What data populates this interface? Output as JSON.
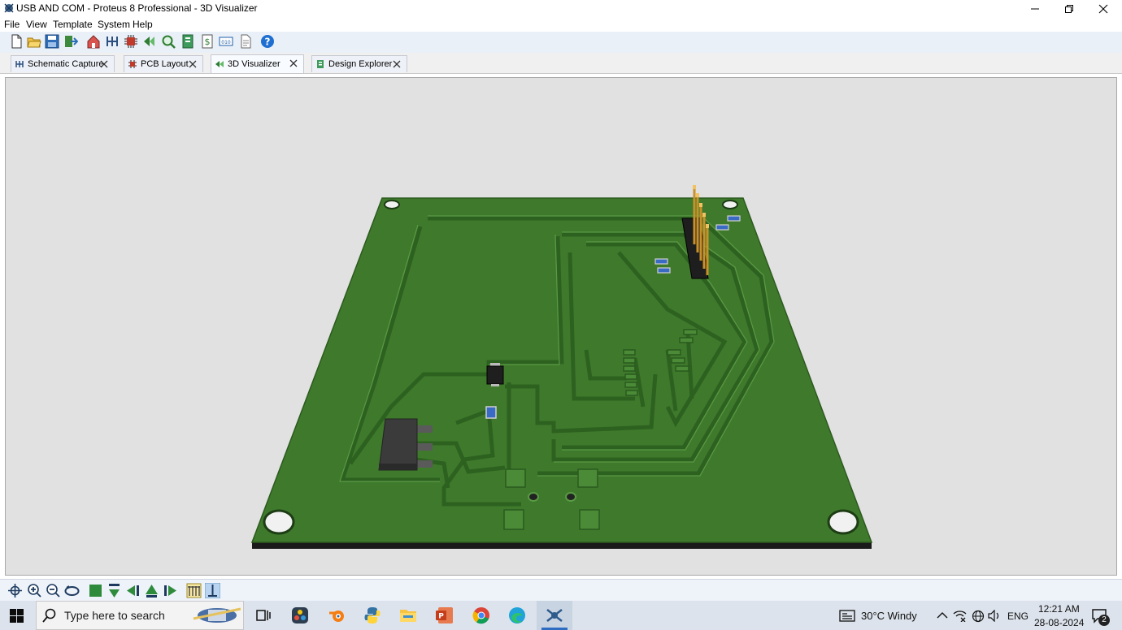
{
  "window": {
    "title": "USB AND COM - Proteus 8 Professional - 3D Visualizer"
  },
  "menu": {
    "items": [
      "File",
      "View",
      "Template",
      "System",
      "Help"
    ]
  },
  "toolbar": {
    "icons": [
      "new-file-icon",
      "open-folder-icon",
      "save-icon",
      "import-icon",
      "home-icon",
      "schematic-icon",
      "pcb-icon",
      "3d-visualizer-icon",
      "zoom-icon",
      "design-explorer-icon",
      "bill-of-materials-icon",
      "notes-icon",
      "document-icon",
      "help-icon"
    ]
  },
  "tabs": [
    {
      "label": "Schematic Capture",
      "icon": "schematic-icon",
      "active": false
    },
    {
      "label": "PCB Layout",
      "icon": "pcb-icon",
      "active": false
    },
    {
      "label": "3D Visualizer",
      "icon": "3d-visualizer-icon",
      "active": true
    },
    {
      "label": "Design Explorer",
      "icon": "design-explorer-icon",
      "active": false
    }
  ],
  "colors": {
    "board": "#3f7a2c",
    "board_edge": "#2c5a1e",
    "trace": "#4e8b3a",
    "viewport_bg": "#e1e1e1",
    "taskbar": "#dce3ec"
  },
  "bottom_toolbar": {
    "icons": [
      "pan-icon",
      "zoom-in-icon",
      "zoom-out-icon",
      "rotate-icon",
      "board-view-icon",
      "view-top-icon",
      "view-left-icon",
      "view-front-icon",
      "view-right-icon",
      "show-height-icon",
      "height-marker-icon"
    ]
  },
  "taskbar": {
    "search_placeholder": "Type here to search",
    "weather": "30°C  Windy",
    "language": "ENG",
    "time": "12:21 AM",
    "date": "28-08-2024",
    "notification_count": "2",
    "apps": [
      "task-view-icon",
      "davinci-resolve-icon",
      "blender-icon",
      "python-icon",
      "file-explorer-icon",
      "powerpoint-icon",
      "chrome-icon",
      "edge-icon",
      "proteus-icon"
    ]
  }
}
